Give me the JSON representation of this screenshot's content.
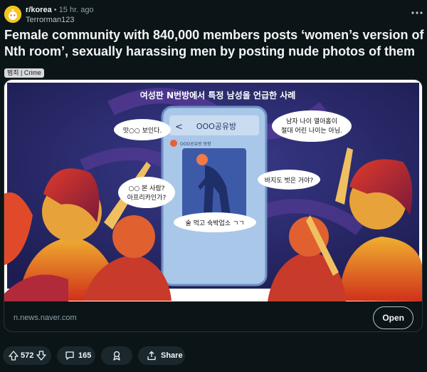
{
  "post": {
    "subreddit": "r/korea",
    "separator": "•",
    "time": "15 hr. ago",
    "author": "Terrorman123",
    "title": "Female community with 840,000 members posts ‘women’s version of Nth room’, sexually harassing men by posting nude photos of them",
    "flair": "범죄 | Crime"
  },
  "illustration": {
    "heading": "여성판 N번방에서 특정 남성을 언급한 사례",
    "phone_title": "OOO공유방",
    "phone_sub": "OOO공유방 방장",
    "back_glyph": "<",
    "bubbles": {
      "b1": "맛○○ 보인다.",
      "b2_line1": "○○ 본 사람?",
      "b2_line2": "아프리카인가?",
      "b3": "술 먹고 숙박업소 ㄱㄱ",
      "b4_line1": "남자 나이 열아홉이",
      "b4_line2": "절대 어린 나이는 아님.",
      "b5": "바지도 벗은 거야?"
    }
  },
  "link": {
    "domain": "n.news.naver.com",
    "open_label": "Open"
  },
  "actions": {
    "votes": "572",
    "comments": "165",
    "share_label": "Share"
  },
  "icons": [
    "snoo-avatar-icon",
    "more-options-icon",
    "upvote-icon",
    "downvote-icon",
    "comment-icon",
    "award-icon",
    "share-icon",
    "back-chevron-icon",
    "figure-icon"
  ],
  "colors": {
    "background": "#0b1416",
    "pill": "#1a282d",
    "flair": "#d7dadc",
    "illustration_bg": "#2a2a6e"
  }
}
